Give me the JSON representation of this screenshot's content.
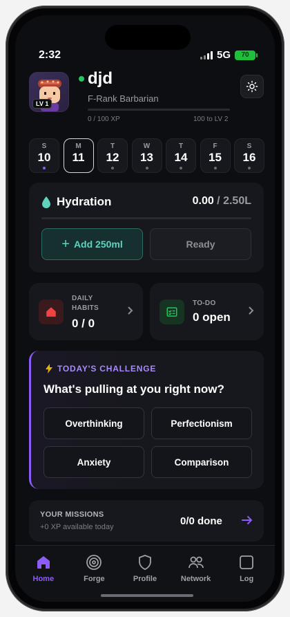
{
  "status": {
    "time": "2:32",
    "network": "5G",
    "battery": "70"
  },
  "profile": {
    "name": "djd",
    "rank": "F-Rank Barbarian",
    "level_badge": "LV 1",
    "xp_progress": "0 / 100 XP",
    "xp_to_next": "100 to LV 2",
    "xp_fraction": 0
  },
  "days": [
    {
      "letter": "S",
      "number": "10",
      "has_dot": true,
      "dot_color": "#8b5cf6",
      "active": false
    },
    {
      "letter": "M",
      "number": "11",
      "has_dot": false,
      "active": true
    },
    {
      "letter": "T",
      "number": "12",
      "has_dot": true,
      "active": false
    },
    {
      "letter": "W",
      "number": "13",
      "has_dot": true,
      "active": false
    },
    {
      "letter": "T",
      "number": "14",
      "has_dot": true,
      "active": false
    },
    {
      "letter": "F",
      "number": "15",
      "has_dot": true,
      "active": false
    },
    {
      "letter": "S",
      "number": "16",
      "has_dot": true,
      "active": false
    }
  ],
  "hydration": {
    "title": "Hydration",
    "current": "0.00",
    "separator": " / ",
    "goal": "2.50L",
    "fraction": 0,
    "add_label": "Add 250ml",
    "ready_label": "Ready"
  },
  "habits": {
    "label": "DAILY HABITS",
    "value": "0 / 0"
  },
  "todo": {
    "label": "TO-DO",
    "value": "0 open"
  },
  "challenge": {
    "tag": "TODAY'S CHALLENGE",
    "question": "What's pulling at you right now?",
    "options": [
      "Overthinking",
      "Perfectionism",
      "Anxiety",
      "Comparison"
    ]
  },
  "missions": {
    "title": "YOUR MISSIONS",
    "subtitle": "+0 XP available today",
    "value": "0/0 done"
  },
  "tabs": [
    {
      "label": "Home",
      "icon": "home-icon",
      "active": true
    },
    {
      "label": "Forge",
      "icon": "target-icon",
      "active": false
    },
    {
      "label": "Profile",
      "icon": "shield-icon",
      "active": false
    },
    {
      "label": "Network",
      "icon": "users-icon",
      "active": false
    },
    {
      "label": "Log",
      "icon": "square-icon",
      "active": false
    }
  ],
  "colors": {
    "accent": "#8b5cf6",
    "hydration": "#5fd3c0",
    "online": "#22c55e",
    "habits": "#ef4444",
    "todo": "#22c55e"
  }
}
